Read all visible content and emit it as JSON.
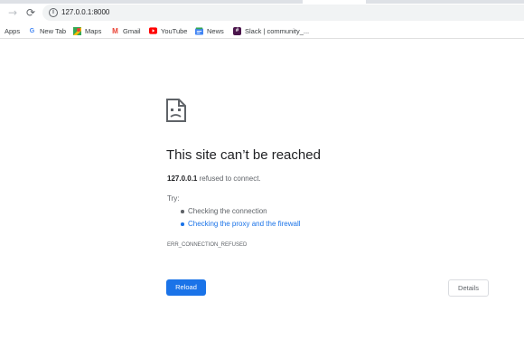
{
  "toolbar": {
    "url": "127.0.0.1:8000"
  },
  "bookmarks": {
    "apps": "Apps",
    "items": [
      {
        "label": "New Tab",
        "icon": "google-icon"
      },
      {
        "label": "Maps",
        "icon": "maps-icon"
      },
      {
        "label": "Gmail",
        "icon": "gmail-icon"
      },
      {
        "label": "YouTube",
        "icon": "youtube-icon"
      },
      {
        "label": "News",
        "icon": "news-icon"
      },
      {
        "label": "Slack | community_...",
        "icon": "slack-icon"
      }
    ]
  },
  "error": {
    "title": "This site can’t be reached",
    "host": "127.0.0.1",
    "message": " refused to connect.",
    "try_label": "Try:",
    "suggestions": [
      "Checking the connection",
      "Checking the proxy and the firewall"
    ],
    "code": "ERR_CONNECTION_REFUSED",
    "reload_label": "Reload",
    "details_label": "Details"
  },
  "colors": {
    "accent": "#1a73e8",
    "text": "#202124",
    "secondary_text": "#5f6368"
  }
}
